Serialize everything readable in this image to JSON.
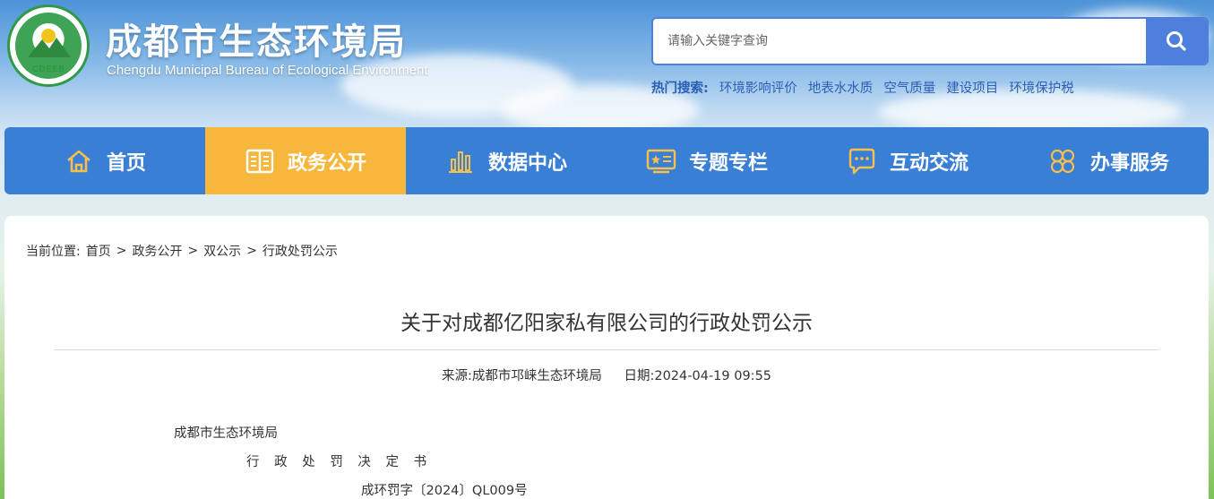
{
  "header": {
    "logo_text": "CDEEB",
    "title": "成都市生态环境局",
    "subtitle": "Chengdu Municipal Bureau of Ecological Environment"
  },
  "search": {
    "placeholder": "请输入关键字查询",
    "button_icon": "search-icon"
  },
  "hot_search": {
    "label": "热门搜索:",
    "links": [
      "环境影响评价",
      "地表水水质",
      "空气质量",
      "建设项目",
      "环境保护税"
    ]
  },
  "nav": {
    "items": [
      {
        "label": "首页",
        "icon": "home-icon",
        "active": false
      },
      {
        "label": "政务公开",
        "icon": "book-icon",
        "active": true
      },
      {
        "label": "数据中心",
        "icon": "bar-chart-icon",
        "active": false
      },
      {
        "label": "专题专栏",
        "icon": "board-icon",
        "active": false
      },
      {
        "label": "互动交流",
        "icon": "chat-icon",
        "active": false
      },
      {
        "label": "办事服务",
        "icon": "clover-icon",
        "active": false
      }
    ],
    "colors": {
      "bar": "#3a7fd6",
      "active": "#f6b73c"
    }
  },
  "breadcrumb": {
    "label": "当前位置:",
    "items": [
      "首页",
      "政务公开",
      "双公示",
      "行政处罚公示"
    ],
    "separator": ">"
  },
  "article": {
    "title": "关于对成都亿阳家私有限公司的行政处罚公示",
    "source": "来源:成都市邛崃生态环境局",
    "date": "日期:2024-04-19 09:55",
    "lines": [
      "成都市生态环境局",
      "行 政 处 罚 决 定 书",
      "成环罚字〔2024〕QL009号"
    ]
  }
}
